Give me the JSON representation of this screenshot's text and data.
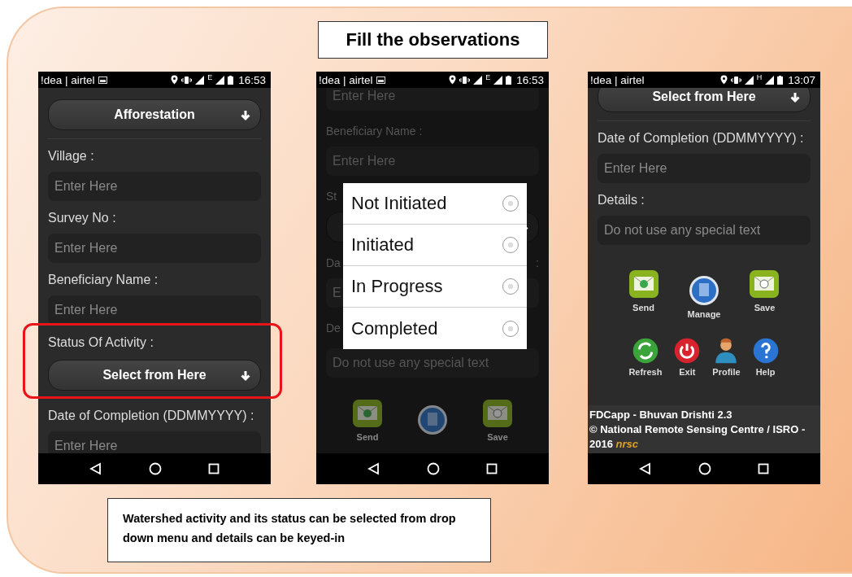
{
  "slide_title": "Fill the observations",
  "phones": [
    {
      "status_bar": {
        "carrier": "!dea | airtel",
        "sim_icon": true,
        "network": "E",
        "time": "16:53"
      },
      "dimmed": false,
      "items": [
        {
          "kind": "select",
          "text": "Afforestation"
        },
        {
          "kind": "divider"
        },
        {
          "kind": "label",
          "text": "Village :"
        },
        {
          "kind": "field",
          "placeholder": "Enter Here"
        },
        {
          "kind": "label",
          "text": "Survey No :"
        },
        {
          "kind": "field",
          "placeholder": "Enter Here"
        },
        {
          "kind": "label",
          "text": "Beneficiary Name :"
        },
        {
          "kind": "field",
          "placeholder": "Enter Here"
        },
        {
          "kind": "group",
          "highlighted": true,
          "children": [
            {
              "kind": "label",
              "text": "Status Of Activity :"
            },
            {
              "kind": "select",
              "text": "Select from Here"
            }
          ]
        },
        {
          "kind": "label",
          "text": "Date of Completion (DDMMYYYY) :"
        },
        {
          "kind": "field",
          "placeholder": "Enter Here"
        }
      ]
    },
    {
      "status_bar": {
        "carrier": "!dea | airtel",
        "sim_icon": true,
        "network": "E",
        "time": "16:53"
      },
      "dimmed": true,
      "items": [
        {
          "kind": "field",
          "placeholder": "Enter Here"
        },
        {
          "kind": "label",
          "text": "Beneficiary Name :"
        },
        {
          "kind": "field",
          "placeholder": "Enter Here"
        },
        {
          "kind": "label",
          "text": "St"
        },
        {
          "kind": "select"
        },
        {
          "kind": "label",
          "text": "Da",
          "trailing": ":"
        },
        {
          "kind": "field",
          "placeholder": "E"
        },
        {
          "kind": "label",
          "text": "De"
        },
        {
          "kind": "field",
          "placeholder": "Do not use any special text"
        }
      ],
      "actions": [
        [
          {
            "kind": "send",
            "label": "Send"
          },
          {
            "kind": "manage"
          },
          {
            "kind": "save",
            "label": "Save"
          }
        ]
      ],
      "dialog": {
        "options": [
          {
            "label": "Not Initiated",
            "selected": false
          },
          {
            "label": "Initiated",
            "selected": false
          },
          {
            "label": "In Progress",
            "selected": false
          },
          {
            "label": "Completed",
            "selected": false
          }
        ]
      }
    },
    {
      "status_bar": {
        "carrier": "!dea | airtel",
        "sim_icon": false,
        "network": "H",
        "time": "13:07"
      },
      "dimmed": false,
      "items": [
        {
          "kind": "select",
          "text": "Select from Here"
        },
        {
          "kind": "divider"
        },
        {
          "kind": "label",
          "text": "Date of Completion (DDMMYYYY) :"
        },
        {
          "kind": "field",
          "placeholder": "Enter Here"
        },
        {
          "kind": "label",
          "text": "Details :"
        },
        {
          "kind": "field",
          "placeholder": "Do not use any special text"
        }
      ],
      "actions": [
        [
          {
            "kind": "send",
            "label": "Send"
          },
          {
            "kind": "manage",
            "label": "Manage"
          },
          {
            "kind": "save",
            "label": "Save"
          }
        ],
        [
          {
            "kind": "refresh",
            "label": "Refresh"
          },
          {
            "kind": "exit",
            "label": "Exit"
          },
          {
            "kind": "profile",
            "label": "Profile"
          },
          {
            "kind": "help",
            "label": "Help"
          }
        ]
      ],
      "footer": {
        "app_line": "FDCapp - Bhuvan Drishti 2.3",
        "copyright": "© National Remote Sensing Centre / ISRO - 2016",
        "logo_text": "nrsc"
      }
    }
  ],
  "caption": "Watershed activity and its status can be selected from drop down menu and details can be keyed-in"
}
